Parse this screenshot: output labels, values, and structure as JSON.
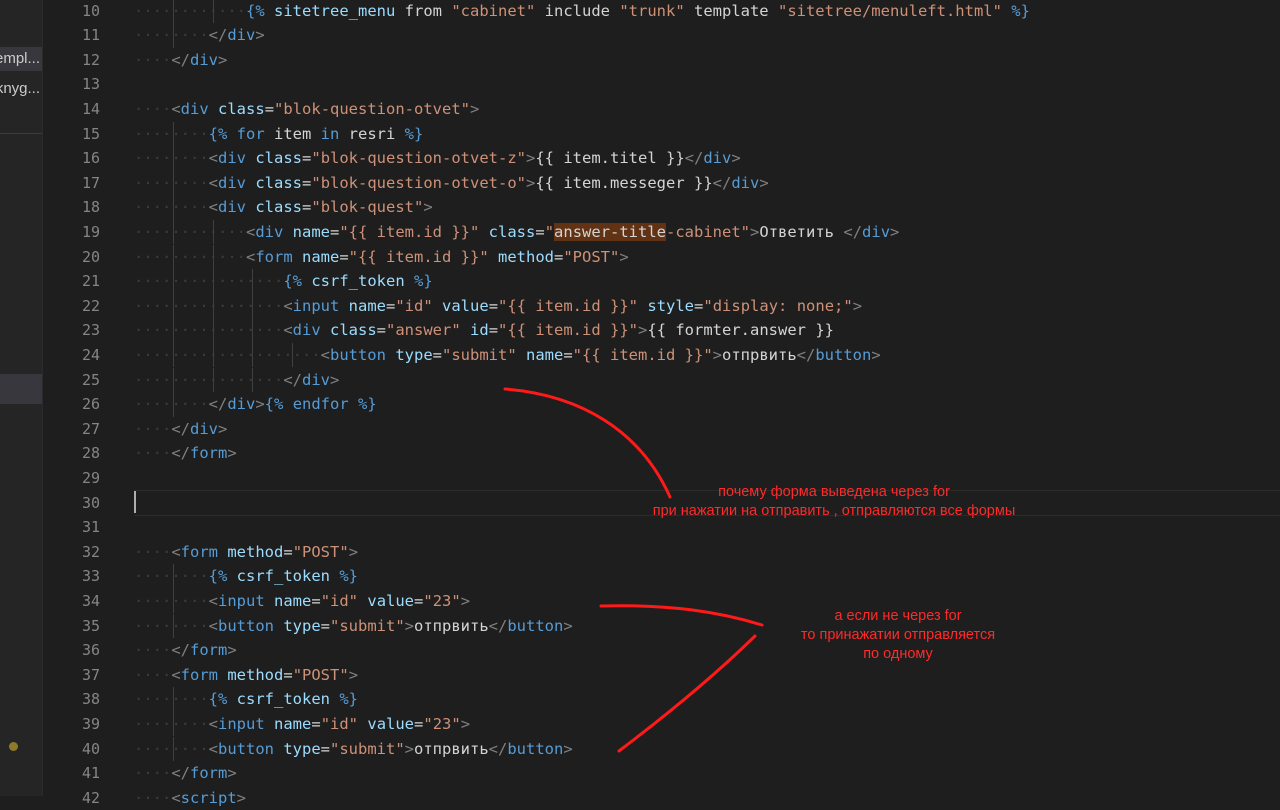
{
  "sidebar": {
    "items": [
      {
        "label": "templ..."
      },
      {
        "label": "knyg..."
      }
    ]
  },
  "gutter": {
    "line_numbers": [
      "10",
      "11",
      "12",
      "13",
      "14",
      "15",
      "16",
      "17",
      "18",
      "19",
      "20",
      "21",
      "22",
      "23",
      "24",
      "25",
      "26",
      "27",
      "28",
      "29",
      "30",
      "31",
      "32",
      "33",
      "34",
      "35",
      "36",
      "37",
      "38",
      "39",
      "40",
      "41",
      "42"
    ]
  },
  "code": [
    {
      "indent": 3,
      "tokens": [
        [
          "kw",
          "{%"
        ],
        [
          "txt",
          " "
        ],
        [
          "attr",
          "sitetree_menu"
        ],
        [
          "txt",
          " from "
        ],
        [
          "str",
          "\"cabinet\""
        ],
        [
          "txt",
          " include "
        ],
        [
          "str",
          "\"trunk\""
        ],
        [
          "txt",
          " template "
        ],
        [
          "str",
          "\"sitetree/menuleft.html\""
        ],
        [
          "txt",
          " "
        ],
        [
          "kw",
          "%}"
        ]
      ]
    },
    {
      "indent": 2,
      "tokens": [
        [
          "br",
          "</"
        ],
        [
          "tag",
          "div"
        ],
        [
          "br",
          ">"
        ]
      ]
    },
    {
      "indent": 1,
      "tokens": [
        [
          "br",
          "</"
        ],
        [
          "tag",
          "div"
        ],
        [
          "br",
          ">"
        ]
      ]
    },
    {
      "indent": 0,
      "tokens": []
    },
    {
      "indent": 1,
      "tokens": [
        [
          "br",
          "<"
        ],
        [
          "tag",
          "div"
        ],
        [
          "txt",
          " "
        ],
        [
          "attr",
          "class"
        ],
        [
          "txt",
          "="
        ],
        [
          "str",
          "\"blok-question-otvet\""
        ],
        [
          "br",
          ">"
        ]
      ]
    },
    {
      "indent": 2,
      "tokens": [
        [
          "kw",
          "{%"
        ],
        [
          "txt",
          " "
        ],
        [
          "kw",
          "for"
        ],
        [
          "txt",
          " item "
        ],
        [
          "kw",
          "in"
        ],
        [
          "txt",
          " resri "
        ],
        [
          "kw",
          "%}"
        ]
      ]
    },
    {
      "indent": 2,
      "tokens": [
        [
          "br",
          "<"
        ],
        [
          "tag",
          "div"
        ],
        [
          "txt",
          " "
        ],
        [
          "attr",
          "class"
        ],
        [
          "txt",
          "="
        ],
        [
          "str",
          "\"blok-question-otvet-z\""
        ],
        [
          "br",
          ">"
        ],
        [
          "txt",
          "{{ item.titel }}"
        ],
        [
          "br",
          "</"
        ],
        [
          "tag",
          "div"
        ],
        [
          "br",
          ">"
        ]
      ]
    },
    {
      "indent": 2,
      "tokens": [
        [
          "br",
          "<"
        ],
        [
          "tag",
          "div"
        ],
        [
          "txt",
          " "
        ],
        [
          "attr",
          "class"
        ],
        [
          "txt",
          "="
        ],
        [
          "str",
          "\"blok-question-otvet-o\""
        ],
        [
          "br",
          ">"
        ],
        [
          "txt",
          "{{ item.messeger }}"
        ],
        [
          "br",
          "</"
        ],
        [
          "tag",
          "div"
        ],
        [
          "br",
          ">"
        ]
      ]
    },
    {
      "indent": 2,
      "tokens": [
        [
          "br",
          "<"
        ],
        [
          "tag",
          "div"
        ],
        [
          "txt",
          " "
        ],
        [
          "attr",
          "class"
        ],
        [
          "txt",
          "="
        ],
        [
          "str",
          "\"blok-quest\""
        ],
        [
          "br",
          ">"
        ]
      ]
    },
    {
      "indent": 3,
      "tokens": [
        [
          "br",
          "<"
        ],
        [
          "tag",
          "div"
        ],
        [
          "txt",
          " "
        ],
        [
          "attr",
          "name"
        ],
        [
          "txt",
          "="
        ],
        [
          "str",
          "\"{{ item.id }}\""
        ],
        [
          "txt",
          " "
        ],
        [
          "attr",
          "class"
        ],
        [
          "txt",
          "="
        ],
        [
          "str",
          "\""
        ],
        [
          "hl",
          "answer-title"
        ],
        [
          "str",
          "-cabinet\""
        ],
        [
          "br",
          ">"
        ],
        [
          "txt",
          "Ответить "
        ],
        [
          "br",
          "</"
        ],
        [
          "tag",
          "div"
        ],
        [
          "br",
          ">"
        ]
      ]
    },
    {
      "indent": 3,
      "tokens": [
        [
          "br",
          "<"
        ],
        [
          "tag",
          "form"
        ],
        [
          "txt",
          " "
        ],
        [
          "attr",
          "name"
        ],
        [
          "txt",
          "="
        ],
        [
          "str",
          "\"{{ item.id }}\""
        ],
        [
          "txt",
          " "
        ],
        [
          "attr",
          "method"
        ],
        [
          "txt",
          "="
        ],
        [
          "str",
          "\"POST\""
        ],
        [
          "br",
          ">"
        ]
      ]
    },
    {
      "indent": 4,
      "tokens": [
        [
          "kw",
          "{%"
        ],
        [
          "txt",
          " "
        ],
        [
          "attr",
          "csrf_token"
        ],
        [
          "txt",
          " "
        ],
        [
          "kw",
          "%}"
        ]
      ]
    },
    {
      "indent": 4,
      "tokens": [
        [
          "br",
          "<"
        ],
        [
          "tag",
          "input"
        ],
        [
          "txt",
          " "
        ],
        [
          "attr",
          "name"
        ],
        [
          "txt",
          "="
        ],
        [
          "str",
          "\"id\""
        ],
        [
          "txt",
          " "
        ],
        [
          "attr",
          "value"
        ],
        [
          "txt",
          "="
        ],
        [
          "str",
          "\"{{ item.id }}\""
        ],
        [
          "txt",
          " "
        ],
        [
          "attr",
          "style"
        ],
        [
          "txt",
          "="
        ],
        [
          "str",
          "\"display: none;\""
        ],
        [
          "br",
          ">"
        ]
      ]
    },
    {
      "indent": 4,
      "tokens": [
        [
          "br",
          "<"
        ],
        [
          "tag",
          "div"
        ],
        [
          "txt",
          " "
        ],
        [
          "attr",
          "class"
        ],
        [
          "txt",
          "="
        ],
        [
          "str",
          "\"answer\""
        ],
        [
          "txt",
          " "
        ],
        [
          "attr",
          "id"
        ],
        [
          "txt",
          "="
        ],
        [
          "str",
          "\"{{ item.id }}\""
        ],
        [
          "br",
          ">"
        ],
        [
          "txt",
          "{{ formter.answer }}"
        ]
      ]
    },
    {
      "indent": 5,
      "tokens": [
        [
          "br",
          "<"
        ],
        [
          "tag",
          "button"
        ],
        [
          "txt",
          " "
        ],
        [
          "attr",
          "type"
        ],
        [
          "txt",
          "="
        ],
        [
          "str",
          "\"submit\""
        ],
        [
          "txt",
          " "
        ],
        [
          "attr",
          "name"
        ],
        [
          "txt",
          "="
        ],
        [
          "str",
          "\"{{ item.id }}\""
        ],
        [
          "br",
          ">"
        ],
        [
          "txt",
          "отпрвить"
        ],
        [
          "br",
          "</"
        ],
        [
          "tag",
          "button"
        ],
        [
          "br",
          ">"
        ]
      ]
    },
    {
      "indent": 4,
      "tokens": [
        [
          "br",
          "</"
        ],
        [
          "tag",
          "div"
        ],
        [
          "br",
          ">"
        ]
      ]
    },
    {
      "indent": 2,
      "tokens": [
        [
          "br",
          "</"
        ],
        [
          "tag",
          "div"
        ],
        [
          "br",
          ">"
        ],
        [
          "kw",
          "{%"
        ],
        [
          "txt",
          " "
        ],
        [
          "kw",
          "endfor"
        ],
        [
          "txt",
          " "
        ],
        [
          "kw",
          "%}"
        ]
      ]
    },
    {
      "indent": 1,
      "tokens": [
        [
          "br",
          "</"
        ],
        [
          "tag",
          "div"
        ],
        [
          "br",
          ">"
        ]
      ]
    },
    {
      "indent": 1,
      "tokens": [
        [
          "br",
          "</"
        ],
        [
          "tag",
          "form"
        ],
        [
          "br",
          ">"
        ]
      ]
    },
    {
      "indent": 0,
      "tokens": []
    },
    {
      "indent": 0,
      "tokens": []
    },
    {
      "indent": 0,
      "tokens": []
    },
    {
      "indent": 1,
      "tokens": [
        [
          "br",
          "<"
        ],
        [
          "tag",
          "form"
        ],
        [
          "txt",
          " "
        ],
        [
          "attr",
          "method"
        ],
        [
          "txt",
          "="
        ],
        [
          "str",
          "\"POST\""
        ],
        [
          "br",
          ">"
        ]
      ]
    },
    {
      "indent": 2,
      "tokens": [
        [
          "kw",
          "{%"
        ],
        [
          "txt",
          " "
        ],
        [
          "attr",
          "csrf_token"
        ],
        [
          "txt",
          " "
        ],
        [
          "kw",
          "%}"
        ]
      ]
    },
    {
      "indent": 2,
      "tokens": [
        [
          "br",
          "<"
        ],
        [
          "tag",
          "input"
        ],
        [
          "txt",
          " "
        ],
        [
          "attr",
          "name"
        ],
        [
          "txt",
          "="
        ],
        [
          "str",
          "\"id\""
        ],
        [
          "txt",
          " "
        ],
        [
          "attr",
          "value"
        ],
        [
          "txt",
          "="
        ],
        [
          "str",
          "\"23\""
        ],
        [
          "br",
          ">"
        ]
      ]
    },
    {
      "indent": 2,
      "tokens": [
        [
          "br",
          "<"
        ],
        [
          "tag",
          "button"
        ],
        [
          "txt",
          " "
        ],
        [
          "attr",
          "type"
        ],
        [
          "txt",
          "="
        ],
        [
          "str",
          "\"submit\""
        ],
        [
          "br",
          ">"
        ],
        [
          "txt",
          "отпрвить"
        ],
        [
          "br",
          "</"
        ],
        [
          "tag",
          "button"
        ],
        [
          "br",
          ">"
        ]
      ]
    },
    {
      "indent": 1,
      "tokens": [
        [
          "br",
          "</"
        ],
        [
          "tag",
          "form"
        ],
        [
          "br",
          ">"
        ]
      ]
    },
    {
      "indent": 1,
      "tokens": [
        [
          "br",
          "<"
        ],
        [
          "tag",
          "form"
        ],
        [
          "txt",
          " "
        ],
        [
          "attr",
          "method"
        ],
        [
          "txt",
          "="
        ],
        [
          "str",
          "\"POST\""
        ],
        [
          "br",
          ">"
        ]
      ]
    },
    {
      "indent": 2,
      "tokens": [
        [
          "kw",
          "{%"
        ],
        [
          "txt",
          " "
        ],
        [
          "attr",
          "csrf_token"
        ],
        [
          "txt",
          " "
        ],
        [
          "kw",
          "%}"
        ]
      ]
    },
    {
      "indent": 2,
      "tokens": [
        [
          "br",
          "<"
        ],
        [
          "tag",
          "input"
        ],
        [
          "txt",
          " "
        ],
        [
          "attr",
          "name"
        ],
        [
          "txt",
          "="
        ],
        [
          "str",
          "\"id\""
        ],
        [
          "txt",
          " "
        ],
        [
          "attr",
          "value"
        ],
        [
          "txt",
          "="
        ],
        [
          "str",
          "\"23\""
        ],
        [
          "br",
          ">"
        ]
      ]
    },
    {
      "indent": 2,
      "tokens": [
        [
          "br",
          "<"
        ],
        [
          "tag",
          "button"
        ],
        [
          "txt",
          " "
        ],
        [
          "attr",
          "type"
        ],
        [
          "txt",
          "="
        ],
        [
          "str",
          "\"submit\""
        ],
        [
          "br",
          ">"
        ],
        [
          "txt",
          "отпрвить"
        ],
        [
          "br",
          "</"
        ],
        [
          "tag",
          "button"
        ],
        [
          "br",
          ">"
        ]
      ]
    },
    {
      "indent": 1,
      "tokens": [
        [
          "br",
          "</"
        ],
        [
          "tag",
          "form"
        ],
        [
          "br",
          ">"
        ]
      ]
    },
    {
      "indent": 1,
      "tokens": [
        [
          "br",
          "<"
        ],
        [
          "tag",
          "script"
        ],
        [
          "br",
          ">"
        ]
      ]
    }
  ],
  "annotations": {
    "note1": {
      "line1": "почему  форма выведена через for",
      "line2": "при нажатии на отправить , отправляются  все формы"
    },
    "note2": {
      "line1": "а если не через for",
      "line2": "то принажатии отправляется",
      "line3": "по одному"
    },
    "color": "#ff2a2a"
  },
  "colors": {
    "background": "#1e1e1e",
    "sidebar": "#252526",
    "tag": "#569cd6",
    "attribute": "#9cdcfe",
    "string": "#ce9178",
    "highlight": "#613214"
  }
}
